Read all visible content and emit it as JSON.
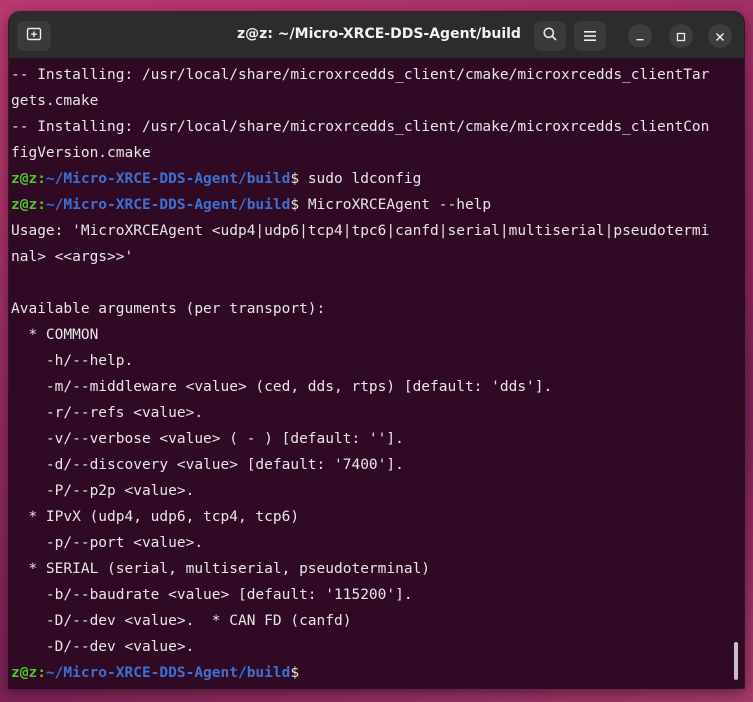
{
  "window": {
    "title": "z@z: ~/Micro-XRCE-DDS-Agent/build"
  },
  "terminal": {
    "lines": [
      {
        "text": "-- Installing: /usr/local/share/microxrcedds_client/cmake/microxrcedds_clientTar"
      },
      {
        "text": "gets.cmake"
      },
      {
        "text": "-- Installing: /usr/local/share/microxrcedds_client/cmake/microxrcedds_clientCon"
      },
      {
        "text": "figVersion.cmake"
      },
      {
        "user": "z@z:",
        "path": "~/Micro-XRCE-DDS-Agent/build",
        "cmd": "$ sudo ldconfig"
      },
      {
        "user": "z@z:",
        "path": "~/Micro-XRCE-DDS-Agent/build",
        "cmd": "$ MicroXRCEAgent --help"
      },
      {
        "text": "Usage: 'MicroXRCEAgent <udp4|udp6|tcp4|tpc6|canfd|serial|multiserial|pseudotermi"
      },
      {
        "text": "nal> <<args>>'"
      },
      {
        "text": ""
      },
      {
        "text": "Available arguments (per transport):"
      },
      {
        "text": "  * COMMON"
      },
      {
        "text": "    -h/--help."
      },
      {
        "text": "    -m/--middleware <value> (ced, dds, rtps) [default: 'dds']."
      },
      {
        "text": "    -r/--refs <value>."
      },
      {
        "text": "    -v/--verbose <value> ( - ) [default: '']."
      },
      {
        "text": "    -d/--discovery <value> [default: '7400']."
      },
      {
        "text": "    -P/--p2p <value>."
      },
      {
        "text": "  * IPvX (udp4, udp6, tcp4, tcp6)"
      },
      {
        "text": "    -p/--port <value>."
      },
      {
        "text": "  * SERIAL (serial, multiserial, pseudoterminal)"
      },
      {
        "text": "    -b/--baudrate <value> [default: '115200']."
      },
      {
        "text": "    -D/--dev <value>.  * CAN FD (canfd)"
      },
      {
        "text": "    -D/--dev <value>."
      },
      {
        "user": "z@z:",
        "path": "~/Micro-XRCE-DDS-Agent/build",
        "cmd": "$ "
      }
    ]
  }
}
